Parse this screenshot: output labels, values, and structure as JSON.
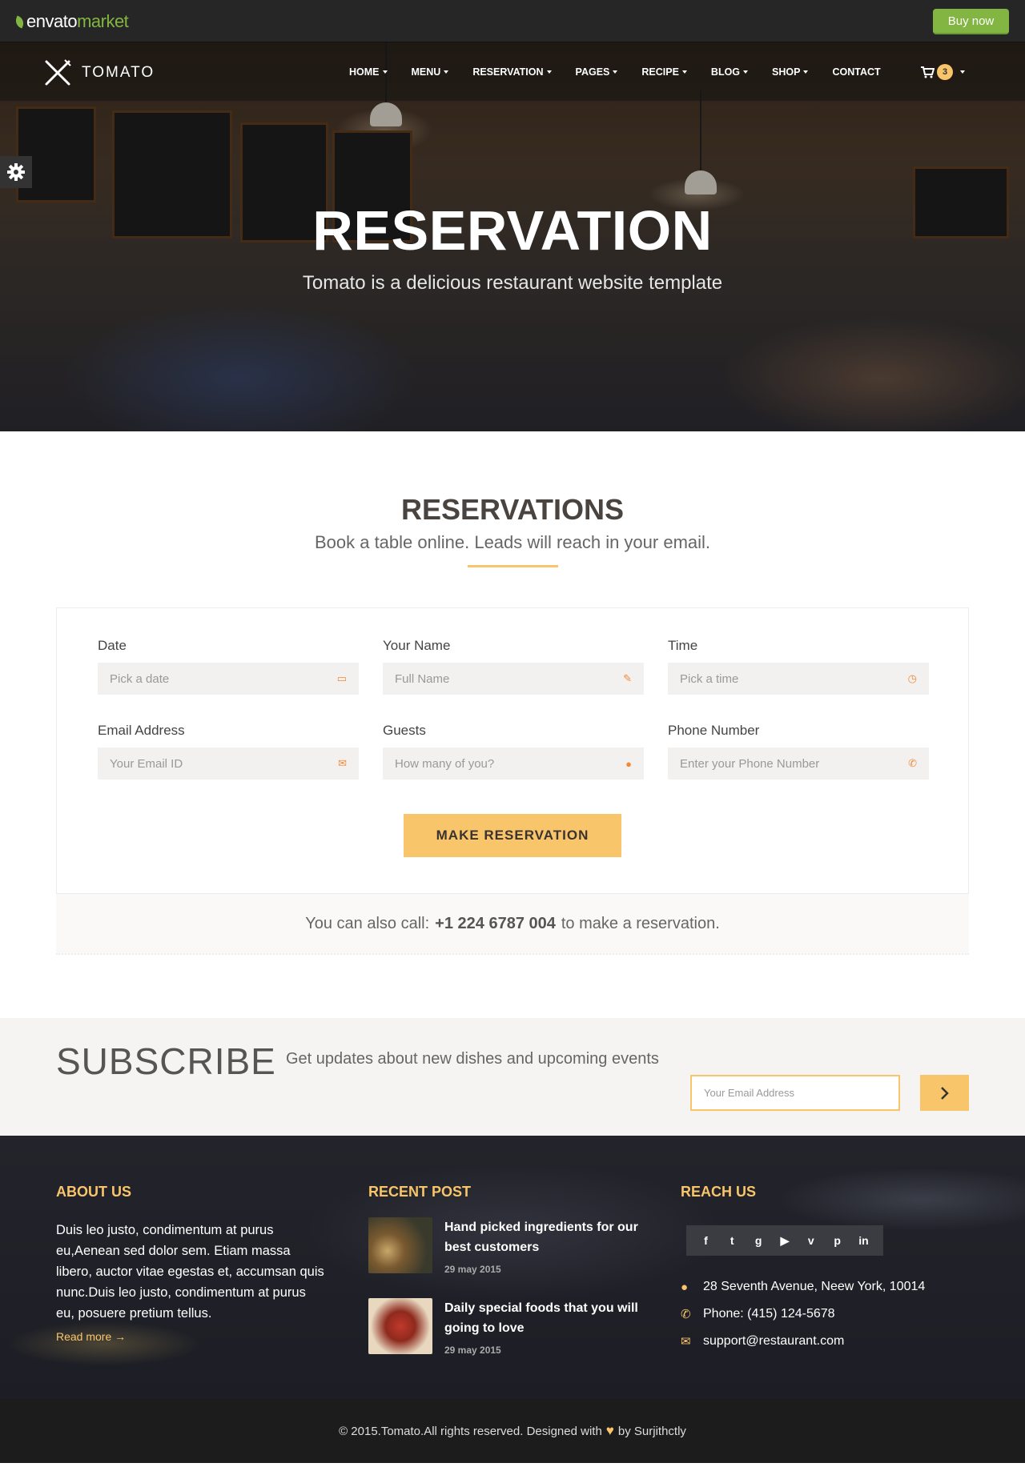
{
  "envato": {
    "logo_main": "envato",
    "logo_suffix": "market",
    "buy_label": "Buy now"
  },
  "nav": {
    "brand": "TOMATO",
    "items": [
      {
        "label": "HOME",
        "dropdown": true
      },
      {
        "label": "MENU",
        "dropdown": true
      },
      {
        "label": "RESERVATION",
        "dropdown": true
      },
      {
        "label": "PAGES",
        "dropdown": true
      },
      {
        "label": "RECIPE",
        "dropdown": true
      },
      {
        "label": "BLOG",
        "dropdown": true
      },
      {
        "label": "SHOP",
        "dropdown": true
      },
      {
        "label": "CONTACT",
        "dropdown": false
      }
    ],
    "cart_count": "3"
  },
  "hero": {
    "title": "RESERVATION",
    "subtitle": "Tomato is a delicious restaurant website template"
  },
  "reservations": {
    "title": "RESERVATIONS",
    "subtitle": "Book a table online. Leads will reach in your email.",
    "fields": [
      {
        "label": "Date",
        "placeholder": "Pick a date",
        "icon": "calendar-icon"
      },
      {
        "label": "Your Name",
        "placeholder": "Full Name",
        "icon": "id-card-icon"
      },
      {
        "label": "Time",
        "placeholder": "Pick a time",
        "icon": "clock-icon"
      },
      {
        "label": "Email Address",
        "placeholder": "Your Email ID",
        "icon": "envelope-icon"
      },
      {
        "label": "Guests",
        "placeholder": "How many of you?",
        "icon": "user-icon"
      },
      {
        "label": "Phone Number",
        "placeholder": "Enter your Phone Number",
        "icon": "phone-icon"
      }
    ],
    "button_label": "MAKE RESERVATION",
    "call_prefix": "You can also call:",
    "call_number": "+1 224 6787 004",
    "call_suffix": "to make a reservation."
  },
  "subscribe": {
    "title": "SUBSCRIBE",
    "text": "Get updates about new dishes and upcoming events",
    "placeholder": "Your Email Address"
  },
  "footer": {
    "about": {
      "heading": "ABOUT US",
      "text": "Duis leo justo, condimentum at purus eu,Aenean sed dolor sem. Etiam massa libero, auctor vitae egestas et, accumsan quis nunc.Duis leo justo, condimentum at purus eu, posuere pretium tellus.",
      "read_more": "Read more →"
    },
    "recent": {
      "heading": "RECENT POST",
      "posts": [
        {
          "title": "Hand picked ingredients for our best customers",
          "date": "29 may 2015"
        },
        {
          "title": "Daily special foods that you will going to love",
          "date": "29 may 2015"
        }
      ]
    },
    "reach": {
      "heading": "REACH US",
      "social": [
        "facebook-icon",
        "twitter-icon",
        "google-plus-icon",
        "youtube-icon",
        "vimeo-icon",
        "pinterest-icon",
        "linkedin-icon"
      ],
      "address": "28 Seventh Avenue, Neew York, 10014",
      "phone": "Phone: (415) 124-5678",
      "email": "support@restaurant.com"
    },
    "copyright_pre": "© 2015.Tomato.All rights reserved. Designed with",
    "copyright_post": "by Surjithctly"
  },
  "colors": {
    "accent": "#f9c56a",
    "envato_green": "#82b541",
    "footer_bg": "#1d1e25"
  }
}
